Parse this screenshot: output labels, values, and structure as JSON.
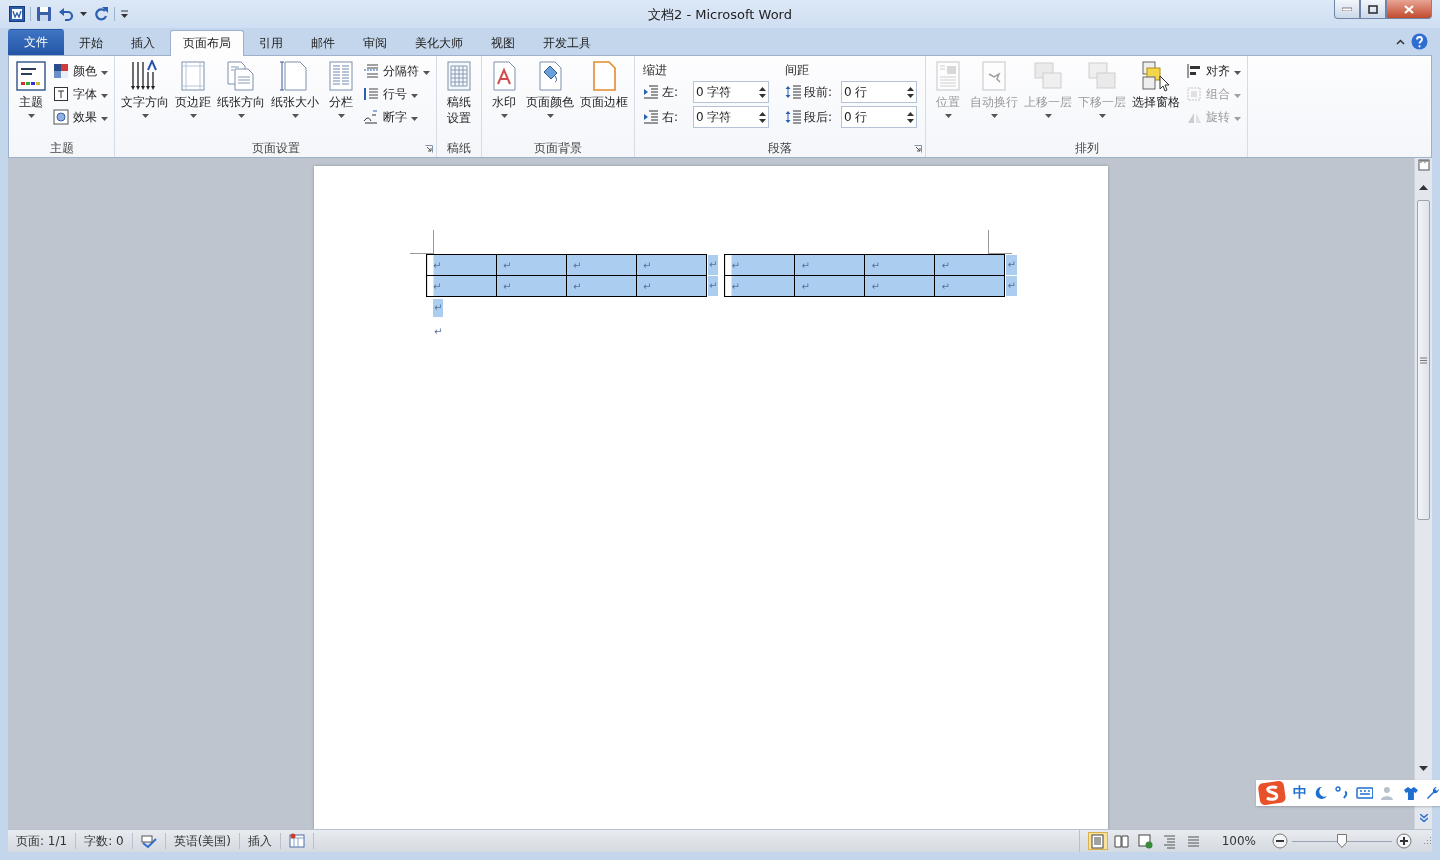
{
  "window": {
    "title": "文档2 - Microsoft Word"
  },
  "tabs": [
    {
      "label": "文件",
      "kind": "backstage",
      "selected": false
    },
    {
      "label": "开始",
      "kind": "tab",
      "selected": false
    },
    {
      "label": "插入",
      "kind": "tab",
      "selected": false
    },
    {
      "label": "页面布局",
      "kind": "tab",
      "selected": true
    },
    {
      "label": "引用",
      "kind": "tab",
      "selected": false
    },
    {
      "label": "邮件",
      "kind": "tab",
      "selected": false
    },
    {
      "label": "审阅",
      "kind": "tab",
      "selected": false
    },
    {
      "label": "美化大师",
      "kind": "tab",
      "selected": false
    },
    {
      "label": "视图",
      "kind": "tab",
      "selected": false
    },
    {
      "label": "开发工具",
      "kind": "tab",
      "selected": false
    }
  ],
  "ribbon": {
    "groups": [
      {
        "label": "主题",
        "launcher": false,
        "items": [
          {
            "kind": "large",
            "label": "主题",
            "dropdown": true,
            "disabled": false
          },
          {
            "kind": "stack",
            "items": [
              {
                "label": "颜色",
                "dropdown": true,
                "disabled": false
              },
              {
                "label": "字体",
                "dropdown": true,
                "disabled": false
              },
              {
                "label": "效果",
                "dropdown": true,
                "disabled": false
              }
            ]
          }
        ]
      },
      {
        "label": "页面设置",
        "launcher": true,
        "items": [
          {
            "kind": "large",
            "label": "文字方向",
            "dropdown": true,
            "disabled": false
          },
          {
            "kind": "large",
            "label": "页边距",
            "dropdown": true,
            "disabled": false
          },
          {
            "kind": "large",
            "label": "纸张方向",
            "dropdown": true,
            "disabled": false
          },
          {
            "kind": "large",
            "label": "纸张大小",
            "dropdown": true,
            "disabled": false
          },
          {
            "kind": "large",
            "label": "分栏",
            "dropdown": true,
            "disabled": false
          },
          {
            "kind": "stack",
            "items": [
              {
                "label": "分隔符",
                "dropdown": true,
                "disabled": false
              },
              {
                "label": "行号",
                "dropdown": true,
                "disabled": false
              },
              {
                "label": "断字",
                "dropdown": true,
                "disabled": false
              }
            ]
          }
        ]
      },
      {
        "label": "稿纸",
        "launcher": false,
        "items": [
          {
            "kind": "large_narrow",
            "label": "稿纸设置",
            "dropdown": false,
            "disabled": false
          }
        ]
      },
      {
        "label": "页面背景",
        "launcher": false,
        "items": [
          {
            "kind": "large",
            "label": "水印",
            "dropdown": true,
            "disabled": false
          },
          {
            "kind": "large",
            "label": "页面颜色",
            "dropdown": true,
            "disabled": false
          },
          {
            "kind": "large",
            "label": "页面边框",
            "dropdown": false,
            "disabled": false
          }
        ]
      },
      {
        "label": "段落",
        "launcher": true,
        "items": [
          {
            "kind": "fields",
            "heading": "缩进",
            "rows": [
              {
                "label": "左:",
                "value": "0 字符"
              },
              {
                "label": "右:",
                "value": "0 字符"
              }
            ]
          },
          {
            "kind": "fields",
            "heading": "间距",
            "rows": [
              {
                "label": "段前:",
                "value": "0 行"
              },
              {
                "label": "段后:",
                "value": "0 行"
              }
            ]
          }
        ]
      },
      {
        "label": "排列",
        "launcher": false,
        "items": [
          {
            "kind": "large",
            "label": "位置",
            "dropdown": true,
            "disabled": true
          },
          {
            "kind": "large",
            "label": "自动换行",
            "dropdown": true,
            "disabled": true
          },
          {
            "kind": "large",
            "label": "上移一层",
            "dropdown": true,
            "disabled": true
          },
          {
            "kind": "large",
            "label": "下移一层",
            "dropdown": true,
            "disabled": true
          },
          {
            "kind": "large",
            "label": "选择窗格",
            "dropdown": false,
            "disabled": false
          },
          {
            "kind": "stack",
            "items": [
              {
                "label": "对齐",
                "dropdown": true,
                "disabled": false
              },
              {
                "label": "组合",
                "dropdown": true,
                "disabled": true
              },
              {
                "label": "旋转",
                "dropdown": true,
                "disabled": true
              }
            ]
          }
        ]
      }
    ]
  },
  "document": {
    "tables": [
      {
        "selected": true,
        "rows": [
          {
            "cells": [
              "↵",
              "↵",
              "↵",
              "↵"
            ],
            "end_mark": "↵"
          },
          {
            "cells": [
              "↵",
              "↵",
              "↵",
              "↵"
            ],
            "end_mark": "↵"
          }
        ]
      },
      {
        "selected": true,
        "rows": [
          {
            "cells": [
              "↵",
              "↵",
              "↵",
              "↵"
            ],
            "end_mark": "↵"
          },
          {
            "cells": [
              "↵",
              "↵",
              "↵",
              "↵"
            ],
            "end_mark": "↵"
          }
        ]
      }
    ],
    "paragraphs": [
      {
        "mark": "↵",
        "selected": true
      },
      {
        "mark": "↵",
        "selected": false
      }
    ]
  },
  "ime": {
    "mode": "中"
  },
  "status_bar": {
    "items": [
      {
        "kind": "text",
        "label": "页面: 1/1"
      },
      {
        "kind": "text",
        "label": "字数: 0"
      },
      {
        "kind": "icon"
      },
      {
        "kind": "text",
        "label": "英语(美国)"
      },
      {
        "kind": "text",
        "label": "插入"
      },
      {
        "kind": "icon"
      }
    ],
    "views": [
      {
        "selected": true
      },
      {
        "selected": false
      },
      {
        "selected": false
      },
      {
        "selected": false
      },
      {
        "selected": false
      }
    ],
    "zoom": "100%",
    "zoom_slider": {
      "level": 0.5
    }
  }
}
